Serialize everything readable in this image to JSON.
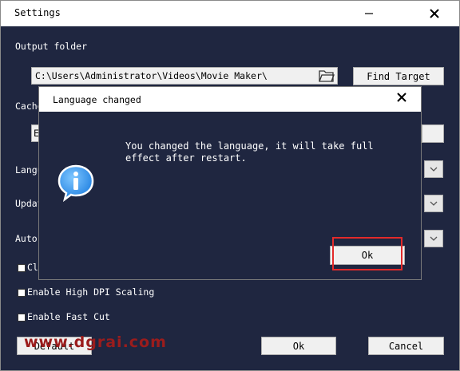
{
  "window": {
    "title": "Settings"
  },
  "settings": {
    "output_folder_label": "Output folder",
    "output_path": "C:\\Users\\Administrator\\Videos\\Movie Maker\\",
    "find_target_label": "Find Target",
    "cache_label_partial": "Cache",
    "cache_path_partial": "E",
    "language_label_partial": "Langu",
    "update_label_partial": "Updat",
    "auto_label_partial": "Auto",
    "checkbox1_partial": "Cl",
    "high_dpi_label": "Enable High DPI Scaling",
    "fast_cut_label": "Enable Fast Cut",
    "default_label": "Default",
    "ok_label": "Ok",
    "cancel_label": "Cancel"
  },
  "dialog": {
    "title": "Language changed",
    "message": "You changed the language, it will take full\neffect after restart.",
    "ok_label": "Ok"
  },
  "watermark": {
    "text": "www.dgrai.com"
  },
  "colors": {
    "background": "#1f2640",
    "highlight": "#e32a2a",
    "watermark": "#9b1c1c"
  },
  "icons": {
    "minimize": "minimize-icon",
    "close": "close-icon",
    "folder": "folder-icon",
    "info": "info-icon",
    "dropdown": "chevron-down-icon"
  }
}
